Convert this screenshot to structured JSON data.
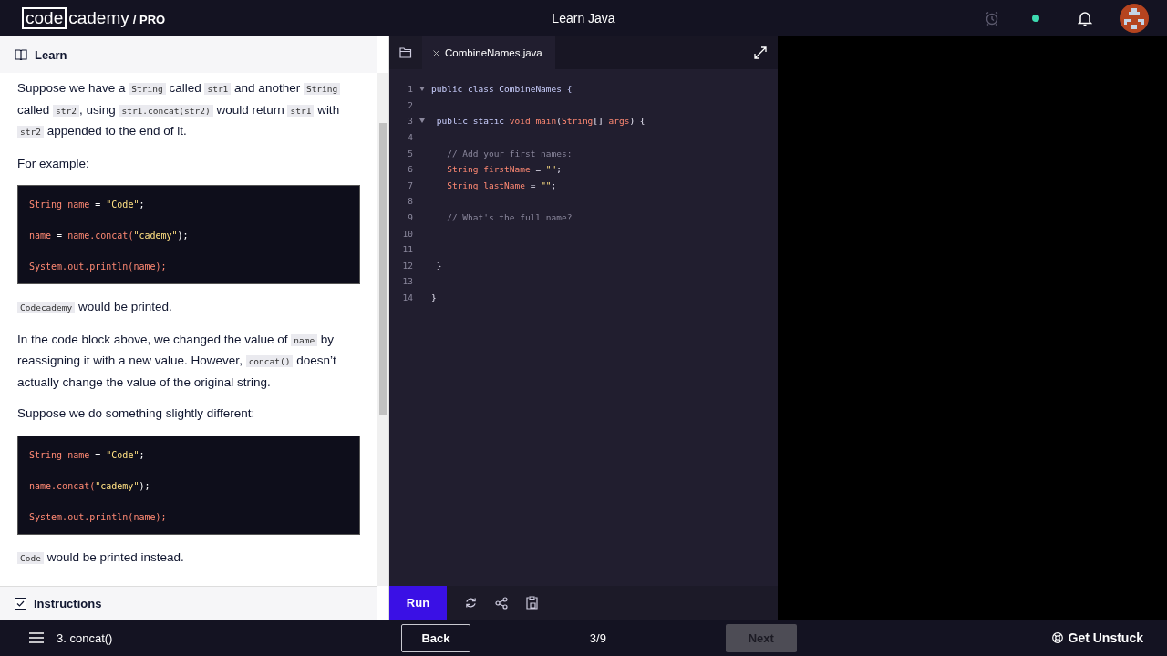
{
  "topbar": {
    "logo": {
      "boxed": "code",
      "rest": "cademy",
      "tier": "/ PRO"
    },
    "title": "Learn Java"
  },
  "lesson": {
    "header": "Learn",
    "content": [
      {
        "kind": "paragraph",
        "runs": [
          {
            "kind": "text",
            "text": "Suppose we have a "
          },
          {
            "kind": "code",
            "text": "String"
          },
          {
            "kind": "text",
            "text": " called "
          },
          {
            "kind": "code",
            "text": "str1"
          },
          {
            "kind": "text",
            "text": " and another "
          },
          {
            "kind": "code",
            "text": "String"
          },
          {
            "kind": "text",
            "text": " called "
          },
          {
            "kind": "code",
            "text": "str2"
          },
          {
            "kind": "text",
            "text": ", using "
          },
          {
            "kind": "code",
            "text": "str1.concat(str2)"
          },
          {
            "kind": "text",
            "text": " would return "
          },
          {
            "kind": "code",
            "text": "str1"
          },
          {
            "kind": "text",
            "text": " with "
          },
          {
            "kind": "code",
            "text": "str2"
          },
          {
            "kind": "text",
            "text": " appended to the end of it."
          }
        ]
      },
      {
        "kind": "paragraph",
        "runs": [
          {
            "kind": "text",
            "text": "For example:"
          }
        ]
      },
      {
        "kind": "codeblock",
        "lines": [
          [
            {
              "kind": "type",
              "text": "String name"
            },
            {
              "kind": "plain",
              "text": " = "
            },
            {
              "kind": "string",
              "text": "\"Code\""
            },
            {
              "kind": "plain",
              "text": ";"
            }
          ],
          [
            {
              "kind": "type",
              "text": "name"
            },
            {
              "kind": "plain",
              "text": " = "
            },
            {
              "kind": "type",
              "text": "name.concat("
            },
            {
              "kind": "string",
              "text": "\"cademy\""
            },
            {
              "kind": "plain",
              "text": ");"
            }
          ],
          [
            {
              "kind": "type",
              "text": "System.out.println(name);"
            }
          ]
        ]
      },
      {
        "kind": "paragraph",
        "runs": [
          {
            "kind": "code",
            "text": "Codecademy"
          },
          {
            "kind": "text",
            "text": " would be printed."
          }
        ]
      },
      {
        "kind": "paragraph",
        "runs": [
          {
            "kind": "text",
            "text": "In the code block above, we changed the value of "
          },
          {
            "kind": "code",
            "text": "name"
          },
          {
            "kind": "text",
            "text": " by reassigning it with a new value. However, "
          },
          {
            "kind": "code",
            "text": "concat()"
          },
          {
            "kind": "text",
            "text": " doesn’t actually change the value of the original string."
          }
        ]
      },
      {
        "kind": "paragraph",
        "runs": [
          {
            "kind": "text",
            "text": "Suppose we do something slightly different:"
          }
        ]
      },
      {
        "kind": "codeblock",
        "lines": [
          [
            {
              "kind": "type",
              "text": "String name"
            },
            {
              "kind": "plain",
              "text": " = "
            },
            {
              "kind": "string",
              "text": "\"Code\""
            },
            {
              "kind": "plain",
              "text": ";"
            }
          ],
          [
            {
              "kind": "type",
              "text": "name.concat("
            },
            {
              "kind": "string",
              "text": "\"cademy\""
            },
            {
              "kind": "plain",
              "text": ");"
            }
          ],
          [
            {
              "kind": "type",
              "text": "System.out.println(name);"
            }
          ]
        ]
      },
      {
        "kind": "paragraph",
        "runs": [
          {
            "kind": "code",
            "text": "Code"
          },
          {
            "kind": "text",
            "text": " would be printed instead."
          }
        ]
      }
    ],
    "instructions": {
      "label": "Instructions",
      "checked": true
    }
  },
  "editor": {
    "tab": "CombineNames.java",
    "lines": [
      {
        "number": "1",
        "fold": true,
        "tokens": [
          {
            "kind": "keyword",
            "text": "public class CombineNames {"
          }
        ]
      },
      {
        "number": "2",
        "fold": false
      },
      {
        "number": "3",
        "fold": true,
        "tokens": [
          {
            "kind": "keyword",
            "text": " public static "
          },
          {
            "kind": "type",
            "text": "void main"
          },
          {
            "kind": "plain",
            "text": "("
          },
          {
            "kind": "type",
            "text": "String"
          },
          {
            "kind": "plain",
            "text": "[] "
          },
          {
            "kind": "type",
            "text": "args"
          },
          {
            "kind": "plain",
            "text": ") {"
          }
        ]
      },
      {
        "number": "4",
        "fold": false
      },
      {
        "number": "5",
        "fold": false,
        "tokens": [
          {
            "kind": "comment",
            "text": "   // Add your first names:"
          }
        ]
      },
      {
        "number": "6",
        "fold": false,
        "tokens": [
          {
            "kind": "type",
            "text": "   String firstName"
          },
          {
            "kind": "plain",
            "text": " = "
          },
          {
            "kind": "string",
            "text": "\"\""
          },
          {
            "kind": "plain",
            "text": ";"
          }
        ]
      },
      {
        "number": "7",
        "fold": false,
        "tokens": [
          {
            "kind": "type",
            "text": "   String lastName"
          },
          {
            "kind": "plain",
            "text": " = "
          },
          {
            "kind": "string",
            "text": "\"\""
          },
          {
            "kind": "plain",
            "text": ";"
          }
        ]
      },
      {
        "number": "8",
        "fold": false
      },
      {
        "number": "9",
        "fold": false,
        "tokens": [
          {
            "kind": "comment",
            "text": "   // What's the full name?"
          }
        ]
      },
      {
        "number": "10",
        "fold": false
      },
      {
        "number": "11",
        "fold": false
      },
      {
        "number": "12",
        "fold": false,
        "tokens": [
          {
            "kind": "plain",
            "text": " }"
          }
        ]
      },
      {
        "number": "13",
        "fold": false
      },
      {
        "number": "14",
        "fold": false,
        "tokens": [
          {
            "kind": "plain",
            "text": "}"
          }
        ]
      }
    ],
    "run": "Run"
  },
  "footer": {
    "lesson": "3. concat()",
    "back": {
      "label": "Back",
      "disabled": false
    },
    "progress": "3/9",
    "next": {
      "label": "Next",
      "disabled": true
    },
    "help": "Get Unstuck"
  }
}
